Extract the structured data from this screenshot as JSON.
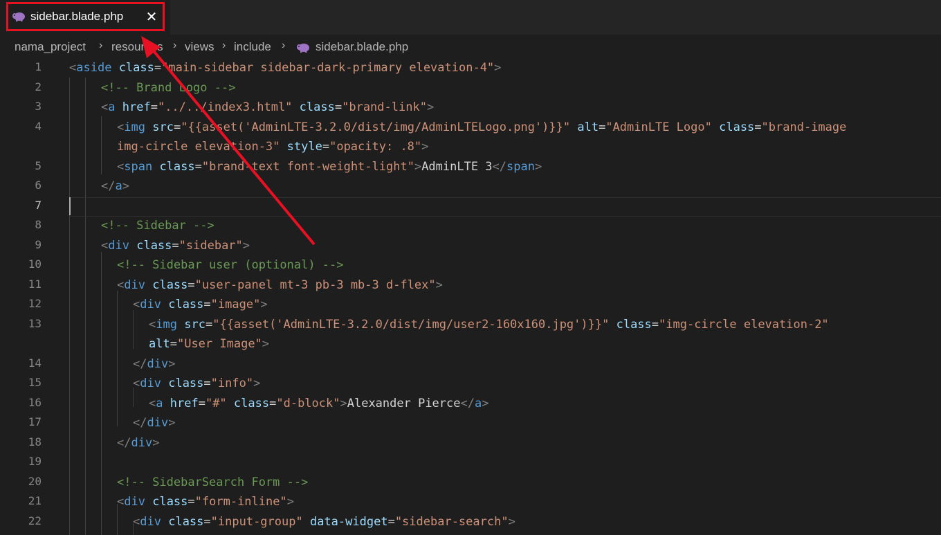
{
  "tab": {
    "label": "sidebar.blade.php",
    "icon": "php-elephant-icon",
    "icon_color": "#a074c4",
    "close_glyph": "✕"
  },
  "breadcrumb": {
    "items": [
      "nama_project",
      "resources",
      "views",
      "include",
      "sidebar.blade.php"
    ],
    "separator": "›"
  },
  "editor": {
    "active_line": "7",
    "lines": [
      {
        "n": "1",
        "tokens": [
          {
            "t": "<",
            "c": "punct"
          },
          {
            "t": "aside",
            "c": "tag"
          },
          {
            "t": " ",
            "c": "text"
          },
          {
            "t": "class",
            "c": "attr"
          },
          {
            "t": "=",
            "c": "text"
          },
          {
            "t": "\"main-sidebar sidebar-dark-primary elevation-4\"",
            "c": "str"
          },
          {
            "t": ">",
            "c": "punct"
          }
        ]
      },
      {
        "n": "2",
        "tokens": [
          {
            "t": "<!-- Brand Logo -->",
            "c": "cmt"
          }
        ]
      },
      {
        "n": "3",
        "tokens": [
          {
            "t": "<",
            "c": "punct"
          },
          {
            "t": "a",
            "c": "tag"
          },
          {
            "t": " ",
            "c": "text"
          },
          {
            "t": "href",
            "c": "attr"
          },
          {
            "t": "=",
            "c": "text"
          },
          {
            "t": "\"../../index3.html\"",
            "c": "str"
          },
          {
            "t": " ",
            "c": "text"
          },
          {
            "t": "class",
            "c": "attr"
          },
          {
            "t": "=",
            "c": "text"
          },
          {
            "t": "\"brand-link\"",
            "c": "str"
          },
          {
            "t": ">",
            "c": "punct"
          }
        ]
      },
      {
        "n": "4",
        "tokens": [
          {
            "t": "<",
            "c": "punct"
          },
          {
            "t": "img",
            "c": "tag"
          },
          {
            "t": " ",
            "c": "text"
          },
          {
            "t": "src",
            "c": "attr"
          },
          {
            "t": "=",
            "c": "text"
          },
          {
            "t": "\"{{asset('AdminLTE-3.2.0/dist/img/AdminLTELogo.png')}}\"",
            "c": "str"
          },
          {
            "t": " ",
            "c": "text"
          },
          {
            "t": "alt",
            "c": "attr"
          },
          {
            "t": "=",
            "c": "text"
          },
          {
            "t": "\"AdminLTE Logo\"",
            "c": "str"
          },
          {
            "t": " ",
            "c": "text"
          },
          {
            "t": "class",
            "c": "attr"
          },
          {
            "t": "=",
            "c": "text"
          },
          {
            "t": "\"brand-image",
            "c": "str"
          }
        ]
      },
      {
        "n": "",
        "tokens": [
          {
            "t": "img-circle elevation-3\"",
            "c": "str"
          },
          {
            "t": " ",
            "c": "text"
          },
          {
            "t": "style",
            "c": "attr"
          },
          {
            "t": "=",
            "c": "text"
          },
          {
            "t": "\"opacity: .8\"",
            "c": "str"
          },
          {
            "t": ">",
            "c": "punct"
          }
        ]
      },
      {
        "n": "5",
        "tokens": [
          {
            "t": "<",
            "c": "punct"
          },
          {
            "t": "span",
            "c": "tag"
          },
          {
            "t": " ",
            "c": "text"
          },
          {
            "t": "class",
            "c": "attr"
          },
          {
            "t": "=",
            "c": "text"
          },
          {
            "t": "\"brand-text font-weight-light\"",
            "c": "str"
          },
          {
            "t": ">",
            "c": "punct"
          },
          {
            "t": "AdminLTE 3",
            "c": "text"
          },
          {
            "t": "</",
            "c": "punct"
          },
          {
            "t": "span",
            "c": "tag"
          },
          {
            "t": ">",
            "c": "punct"
          }
        ]
      },
      {
        "n": "6",
        "tokens": [
          {
            "t": "</",
            "c": "punct"
          },
          {
            "t": "a",
            "c": "tag"
          },
          {
            "t": ">",
            "c": "punct"
          }
        ]
      },
      {
        "n": "7",
        "tokens": []
      },
      {
        "n": "8",
        "tokens": [
          {
            "t": "<!-- Sidebar -->",
            "c": "cmt"
          }
        ]
      },
      {
        "n": "9",
        "tokens": [
          {
            "t": "<",
            "c": "punct"
          },
          {
            "t": "div",
            "c": "tag"
          },
          {
            "t": " ",
            "c": "text"
          },
          {
            "t": "class",
            "c": "attr"
          },
          {
            "t": "=",
            "c": "text"
          },
          {
            "t": "\"sidebar\"",
            "c": "str"
          },
          {
            "t": ">",
            "c": "punct"
          }
        ]
      },
      {
        "n": "10",
        "tokens": [
          {
            "t": "<!-- Sidebar user (optional) -->",
            "c": "cmt"
          }
        ]
      },
      {
        "n": "11",
        "tokens": [
          {
            "t": "<",
            "c": "punct"
          },
          {
            "t": "div",
            "c": "tag"
          },
          {
            "t": " ",
            "c": "text"
          },
          {
            "t": "class",
            "c": "attr"
          },
          {
            "t": "=",
            "c": "text"
          },
          {
            "t": "\"user-panel mt-3 pb-3 mb-3 d-flex\"",
            "c": "str"
          },
          {
            "t": ">",
            "c": "punct"
          }
        ]
      },
      {
        "n": "12",
        "tokens": [
          {
            "t": "<",
            "c": "punct"
          },
          {
            "t": "div",
            "c": "tag"
          },
          {
            "t": " ",
            "c": "text"
          },
          {
            "t": "class",
            "c": "attr"
          },
          {
            "t": "=",
            "c": "text"
          },
          {
            "t": "\"image\"",
            "c": "str"
          },
          {
            "t": ">",
            "c": "punct"
          }
        ]
      },
      {
        "n": "13",
        "tokens": [
          {
            "t": "<",
            "c": "punct"
          },
          {
            "t": "img",
            "c": "tag"
          },
          {
            "t": " ",
            "c": "text"
          },
          {
            "t": "src",
            "c": "attr"
          },
          {
            "t": "=",
            "c": "text"
          },
          {
            "t": "\"{{asset('AdminLTE-3.2.0/dist/img/user2-160x160.jpg')}}\"",
            "c": "str"
          },
          {
            "t": " ",
            "c": "text"
          },
          {
            "t": "class",
            "c": "attr"
          },
          {
            "t": "=",
            "c": "text"
          },
          {
            "t": "\"img-circle elevation-2\"",
            "c": "str"
          }
        ]
      },
      {
        "n": "",
        "tokens": [
          {
            "t": "alt",
            "c": "attr"
          },
          {
            "t": "=",
            "c": "text"
          },
          {
            "t": "\"User Image\"",
            "c": "str"
          },
          {
            "t": ">",
            "c": "punct"
          }
        ]
      },
      {
        "n": "14",
        "tokens": [
          {
            "t": "</",
            "c": "punct"
          },
          {
            "t": "div",
            "c": "tag"
          },
          {
            "t": ">",
            "c": "punct"
          }
        ]
      },
      {
        "n": "15",
        "tokens": [
          {
            "t": "<",
            "c": "punct"
          },
          {
            "t": "div",
            "c": "tag"
          },
          {
            "t": " ",
            "c": "text"
          },
          {
            "t": "class",
            "c": "attr"
          },
          {
            "t": "=",
            "c": "text"
          },
          {
            "t": "\"info\"",
            "c": "str"
          },
          {
            "t": ">",
            "c": "punct"
          }
        ]
      },
      {
        "n": "16",
        "tokens": [
          {
            "t": "<",
            "c": "punct"
          },
          {
            "t": "a",
            "c": "tag"
          },
          {
            "t": " ",
            "c": "text"
          },
          {
            "t": "href",
            "c": "attr"
          },
          {
            "t": "=",
            "c": "text"
          },
          {
            "t": "\"#\"",
            "c": "str"
          },
          {
            "t": " ",
            "c": "text"
          },
          {
            "t": "class",
            "c": "attr"
          },
          {
            "t": "=",
            "c": "text"
          },
          {
            "t": "\"d-block\"",
            "c": "str"
          },
          {
            "t": ">",
            "c": "punct"
          },
          {
            "t": "Alexander Pierce",
            "c": "text"
          },
          {
            "t": "</",
            "c": "punct"
          },
          {
            "t": "a",
            "c": "tag"
          },
          {
            "t": ">",
            "c": "punct"
          }
        ]
      },
      {
        "n": "17",
        "tokens": [
          {
            "t": "</",
            "c": "punct"
          },
          {
            "t": "div",
            "c": "tag"
          },
          {
            "t": ">",
            "c": "punct"
          }
        ]
      },
      {
        "n": "18",
        "tokens": [
          {
            "t": "</",
            "c": "punct"
          },
          {
            "t": "div",
            "c": "tag"
          },
          {
            "t": ">",
            "c": "punct"
          }
        ]
      },
      {
        "n": "19",
        "tokens": []
      },
      {
        "n": "20",
        "tokens": [
          {
            "t": "<!-- SidebarSearch Form -->",
            "c": "cmt"
          }
        ]
      },
      {
        "n": "21",
        "tokens": [
          {
            "t": "<",
            "c": "punct"
          },
          {
            "t": "div",
            "c": "tag"
          },
          {
            "t": " ",
            "c": "text"
          },
          {
            "t": "class",
            "c": "attr"
          },
          {
            "t": "=",
            "c": "text"
          },
          {
            "t": "\"form-inline\"",
            "c": "str"
          },
          {
            "t": ">",
            "c": "punct"
          }
        ]
      },
      {
        "n": "22",
        "tokens": [
          {
            "t": "<",
            "c": "punct"
          },
          {
            "t": "div",
            "c": "tag"
          },
          {
            "t": " ",
            "c": "text"
          },
          {
            "t": "class",
            "c": "attr"
          },
          {
            "t": "=",
            "c": "text"
          },
          {
            "t": "\"input-group\"",
            "c": "str"
          },
          {
            "t": " ",
            "c": "text"
          },
          {
            "t": "data-widget",
            "c": "attr"
          },
          {
            "t": "=",
            "c": "text"
          },
          {
            "t": "\"sidebar-search\"",
            "c": "str"
          },
          {
            "t": ">",
            "c": "punct"
          }
        ]
      }
    ]
  },
  "annotation": {
    "highlight_color": "#e81123",
    "arrow_target": "tab"
  }
}
